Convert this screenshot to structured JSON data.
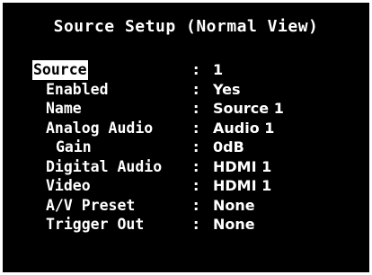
{
  "title": "Source Setup (Normal View)",
  "separator": ":",
  "settings": [
    {
      "label": "Source",
      "value": "1"
    },
    {
      "label": "Enabled",
      "value": "Yes"
    },
    {
      "label": "Name",
      "value": "Source 1"
    },
    {
      "label": "Analog Audio",
      "value": "Audio 1"
    },
    {
      "label": "Gain",
      "value": "0dB"
    },
    {
      "label": "Digital Audio",
      "value": "HDMI 1"
    },
    {
      "label": "Video",
      "value": "HDMI 1"
    },
    {
      "label": "A/V Preset",
      "value": "None"
    },
    {
      "label": "Trigger Out",
      "value": "None"
    }
  ],
  "colors": {
    "background": "#000000",
    "text": "#ffffff",
    "selection_background": "#ffffff",
    "selection_text": "#000000"
  }
}
